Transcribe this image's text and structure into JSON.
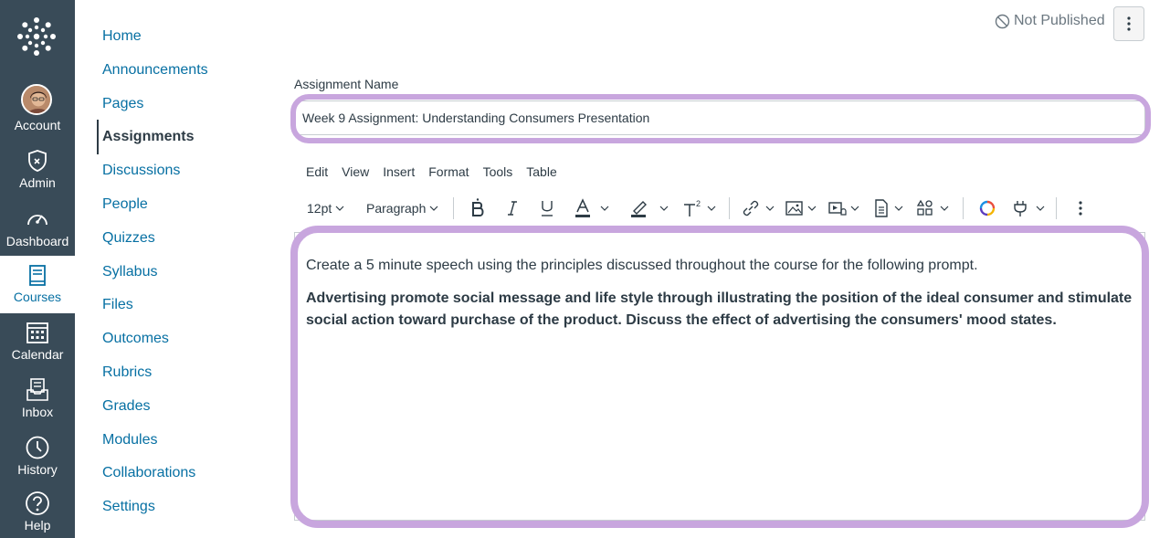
{
  "global_nav": {
    "items": [
      {
        "label": "Account",
        "icon": "user-avatar"
      },
      {
        "label": "Admin",
        "icon": "shield-icon"
      },
      {
        "label": "Dashboard",
        "icon": "speedometer-icon"
      },
      {
        "label": "Courses",
        "icon": "book-icon"
      },
      {
        "label": "Calendar",
        "icon": "calendar-icon"
      },
      {
        "label": "Inbox",
        "icon": "inbox-icon"
      },
      {
        "label": "History",
        "icon": "clock-icon"
      },
      {
        "label": "Help",
        "icon": "question-icon"
      }
    ],
    "active": "Courses"
  },
  "course_nav": {
    "items": [
      "Home",
      "Announcements",
      "Pages",
      "Assignments",
      "Discussions",
      "People",
      "Quizzes",
      "Syllabus",
      "Files",
      "Outcomes",
      "Rubrics",
      "Grades",
      "Modules",
      "Collaborations",
      "Settings"
    ],
    "active": "Assignments"
  },
  "header": {
    "status": "Not Published"
  },
  "assignment": {
    "name_label": "Assignment Name",
    "name_value": "Week 9 Assignment: Understanding Consumers Presentation"
  },
  "editor": {
    "menubar": [
      "Edit",
      "View",
      "Insert",
      "Format",
      "Tools",
      "Table"
    ],
    "font_size": "12pt",
    "block_format": "Paragraph",
    "content": {
      "p1": "Create a 5 minute speech using the principles discussed throughout the course for the following prompt.",
      "p2": "Advertising promote social message and life style through illustrating the position of the ideal consumer and stimulate social action toward purchase of the product. Discuss the effect of advertising the consumers' mood states."
    }
  },
  "colors": {
    "nav_bg": "#394b58",
    "link": "#0770a3",
    "highlight": "#c8a6de",
    "text": "#2d3b45"
  }
}
